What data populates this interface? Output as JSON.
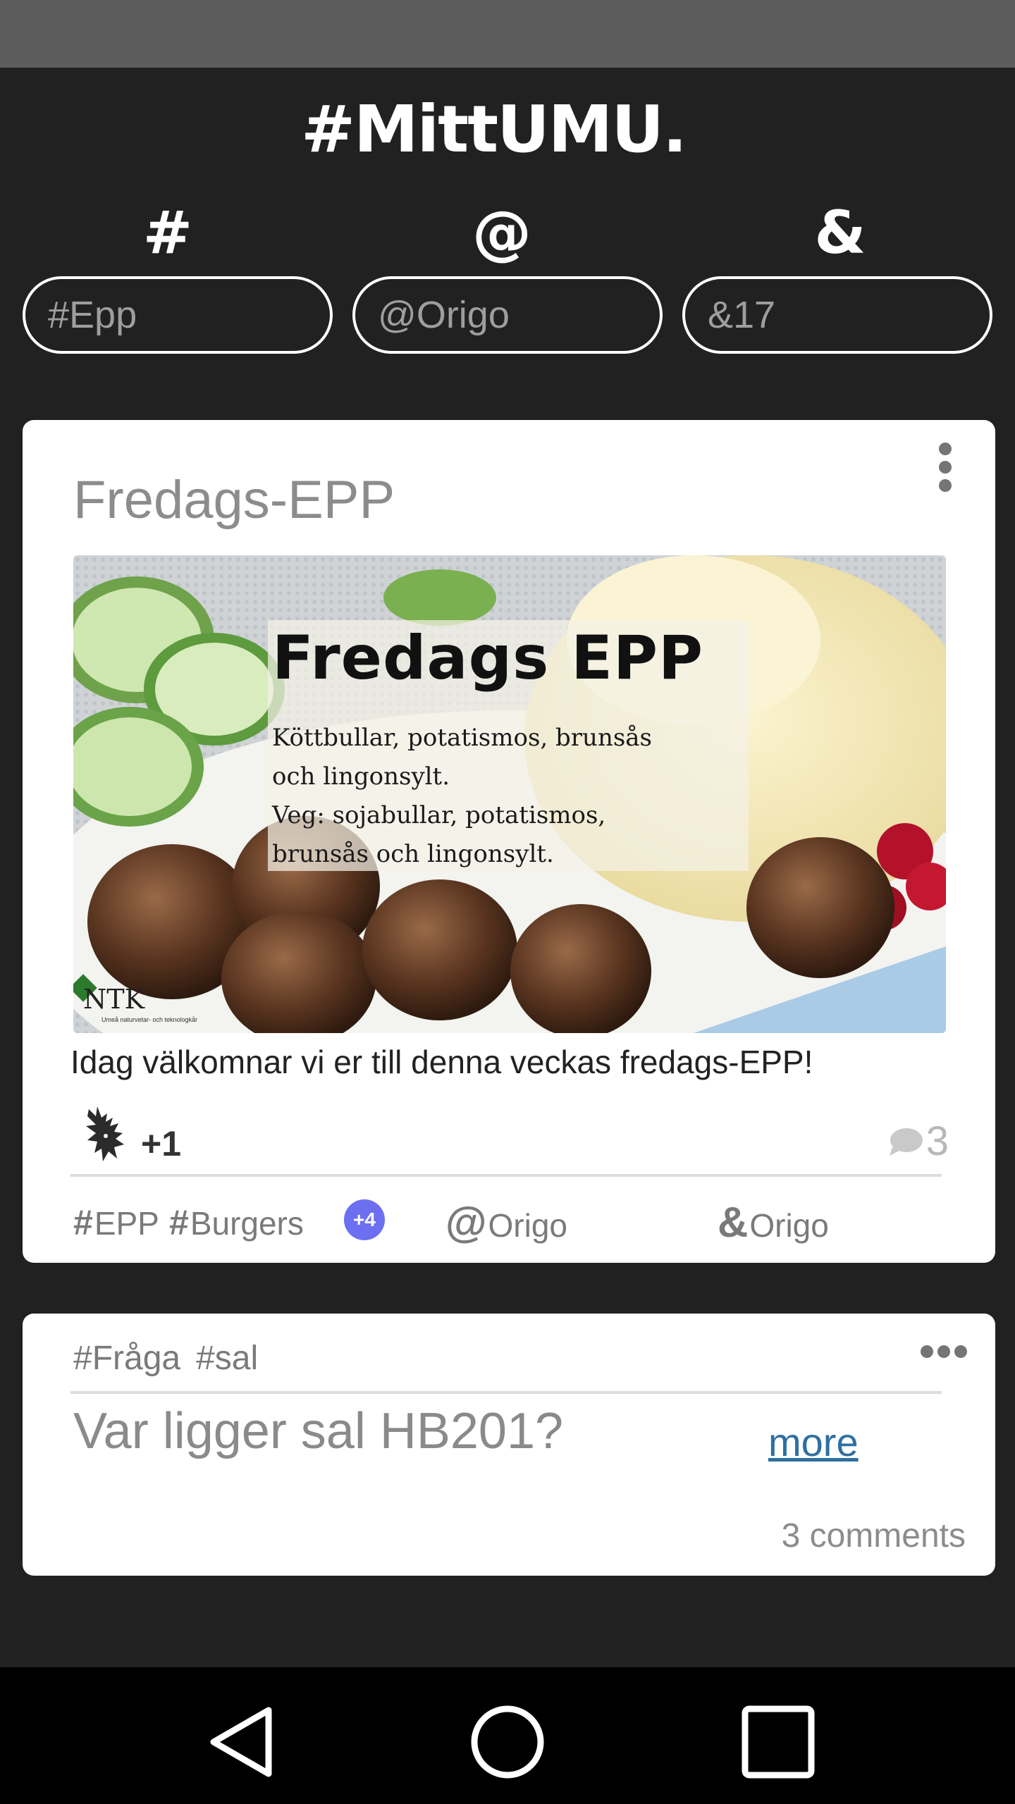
{
  "app": {
    "title": "#MittUMU."
  },
  "filters": {
    "hash": {
      "symbol": "#",
      "value": "#Epp"
    },
    "at": {
      "symbol": "@",
      "value": "@Origo"
    },
    "amp": {
      "symbol": "&",
      "value": "&17"
    }
  },
  "post": {
    "title": "Fredags-EPP",
    "image": {
      "headline": "Fredags EPP",
      "line1": "Köttbullar, potatismos, brunsås",
      "line2": "och lingonsylt.",
      "line3": "Veg: sojabullar, potatismos,",
      "line4": "brunsås och lingonsylt.",
      "logo_text": "NTK",
      "logo_subtext": "Umeå naturvetar- och teknologkår"
    },
    "description": "Idag välkomnar vi er till denna veckas fredags-EPP!",
    "reaction_count": "+1",
    "comment_count": "3",
    "tags": [
      {
        "symbol": "#",
        "label": "EPP"
      },
      {
        "symbol": "#",
        "label": "Burgers"
      }
    ],
    "more_tags_badge": "+4",
    "mention": {
      "symbol": "@",
      "label": "Origo"
    },
    "group": {
      "symbol": "&",
      "label": "Origo"
    }
  },
  "question": {
    "tags": [
      "#Fråga",
      "#sal"
    ],
    "title": "Var ligger sal HB201?",
    "more_label": "more",
    "comments_label": "3 comments"
  },
  "colors": {
    "background": "#212121",
    "badge": "#6b6ff0",
    "link": "#2f6fa0"
  }
}
